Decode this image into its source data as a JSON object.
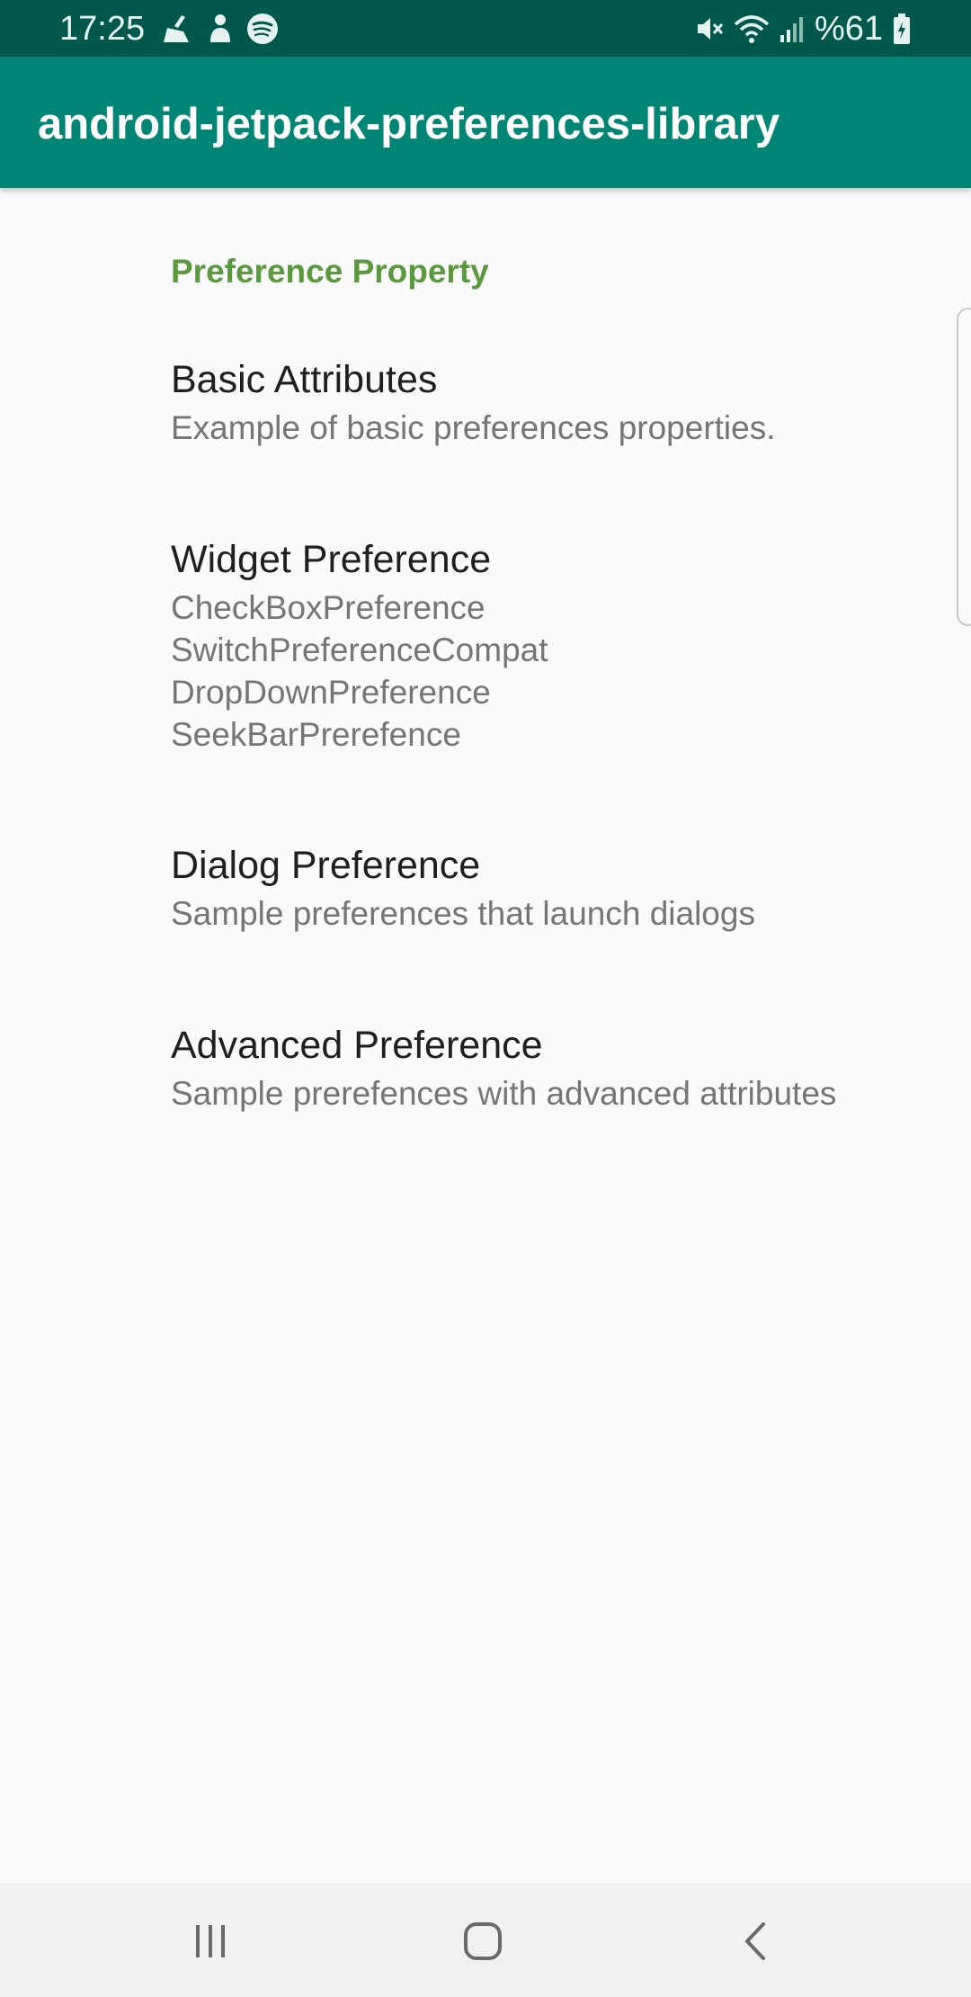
{
  "status_bar": {
    "time": "17:25",
    "battery_text": "%61",
    "left_icons": [
      "broom-icon",
      "person-icon",
      "spotify-icon"
    ],
    "right_icons": [
      "mute-icon",
      "wifi-icon",
      "signal-icon",
      "battery-icon"
    ]
  },
  "app_bar": {
    "title": "android-jetpack-preferences-library",
    "color": "#008577"
  },
  "category": {
    "title": "Preference Property",
    "color": "#5a9a3f"
  },
  "preferences": [
    {
      "title": "Basic Attributes",
      "summary": "Example of basic preferences properties."
    },
    {
      "title": "Widget Preference",
      "summary": "CheckBoxPreference\nSwitchPreferenceCompat\nDropDownPreference\nSeekBarPrerefence"
    },
    {
      "title": "Dialog Preference",
      "summary": "Sample preferences that launch dialogs"
    },
    {
      "title": "Advanced Preference",
      "summary": "Sample prerefences with advanced attributes"
    }
  ],
  "nav_bar": {
    "buttons": [
      "recent-apps-icon",
      "home-icon",
      "back-icon"
    ]
  }
}
